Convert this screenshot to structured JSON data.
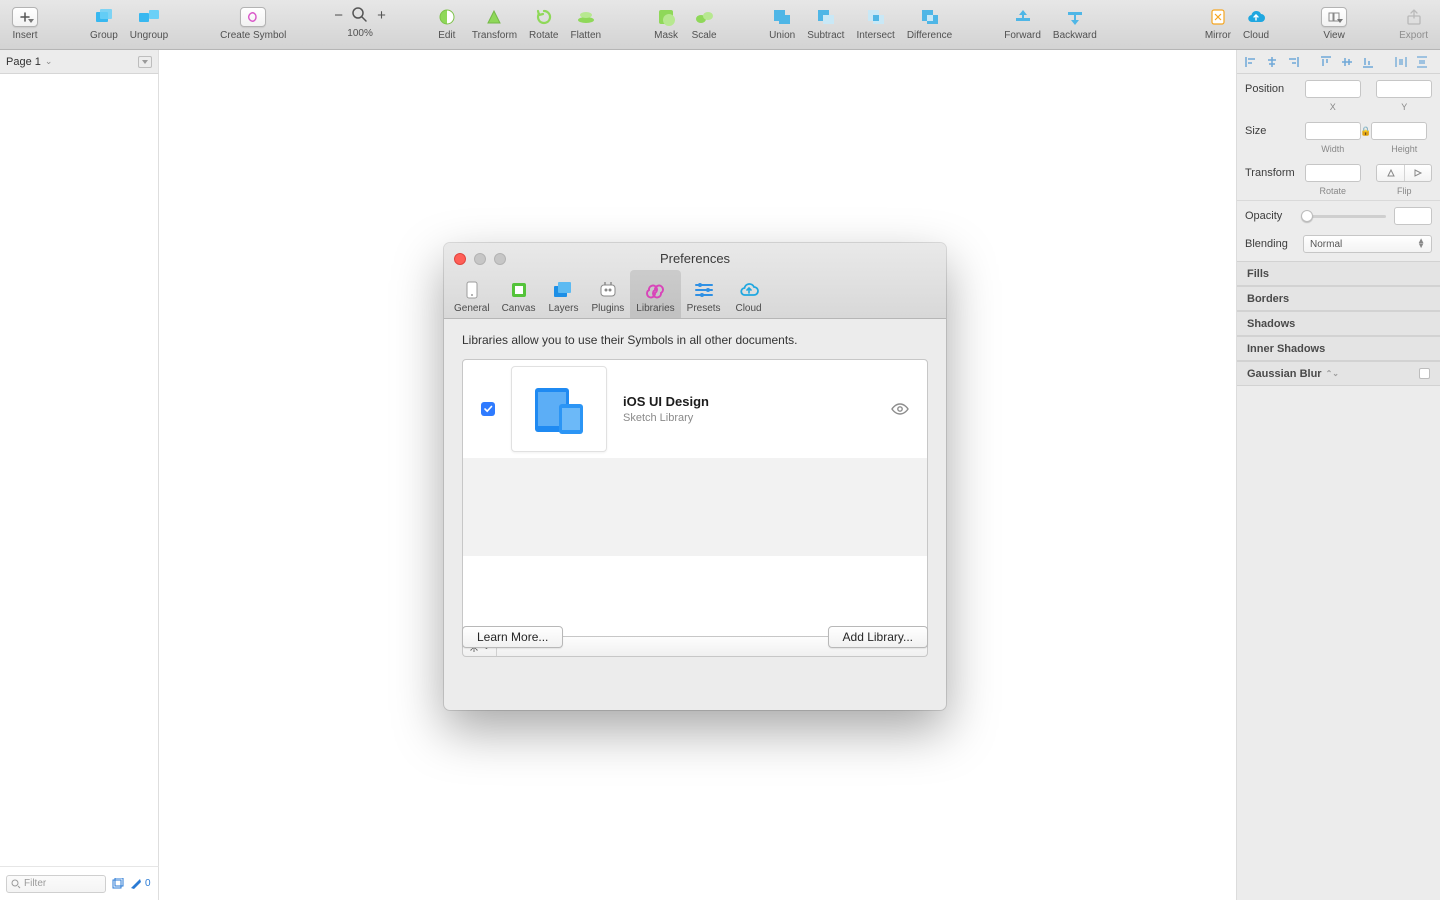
{
  "toolbar": {
    "insert": "Insert",
    "group": "Group",
    "ungroup": "Ungroup",
    "create_symbol": "Create Symbol",
    "zoom_pct": "100%",
    "edit": "Edit",
    "transform": "Transform",
    "rotate": "Rotate",
    "flatten": "Flatten",
    "mask": "Mask",
    "scale": "Scale",
    "union": "Union",
    "subtract": "Subtract",
    "intersect": "Intersect",
    "difference": "Difference",
    "forward": "Forward",
    "backward": "Backward",
    "mirror": "Mirror",
    "cloud": "Cloud",
    "view": "View",
    "export": "Export"
  },
  "pagebar": {
    "page": "Page 1"
  },
  "left_bottom": {
    "filter_ph": "Filter",
    "count": "0"
  },
  "inspector": {
    "position": "Position",
    "x": "X",
    "y": "Y",
    "size": "Size",
    "width": "Width",
    "height": "Height",
    "transform": "Transform",
    "rotate": "Rotate",
    "flip": "Flip",
    "opacity": "Opacity",
    "blending": "Blending",
    "blend_mode": "Normal",
    "fills": "Fills",
    "borders": "Borders",
    "shadows": "Shadows",
    "inner_shadows": "Inner Shadows",
    "gaussian": "Gaussian Blur"
  },
  "prefs": {
    "title": "Preferences",
    "tabs": {
      "general": "General",
      "canvas": "Canvas",
      "layers": "Layers",
      "plugins": "Plugins",
      "libraries": "Libraries",
      "presets": "Presets",
      "cloud": "Cloud"
    },
    "desc": "Libraries allow you to use their Symbols in all other documents.",
    "lib": {
      "title": "iOS UI Design",
      "sub": "Sketch Library"
    },
    "learn": "Learn More...",
    "add": "Add Library..."
  }
}
